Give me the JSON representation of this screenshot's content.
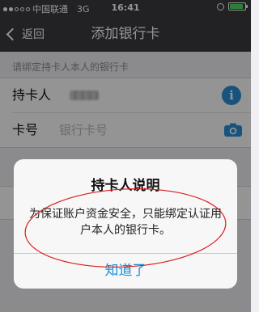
{
  "status_bar": {
    "carrier": "中国联通",
    "network": "3G",
    "time": "16:41",
    "battery_level": 0.9,
    "battery_color": "#4cd964"
  },
  "nav": {
    "back_label": "返回",
    "title": "添加银行卡"
  },
  "form": {
    "section_label": "请绑定持卡人本人的银行卡",
    "holder_label": "持卡人",
    "card_label": "卡号",
    "card_placeholder": "银行卡号",
    "info_icon": "info-icon",
    "camera_icon": "camera-icon"
  },
  "dialog": {
    "title": "持卡人说明",
    "message": "为保证账户资金安全，只能绑定认证用户本人的银行卡。",
    "confirm_label": "知道了",
    "confirm_color": "#1a8fd9"
  },
  "annotation_color": "#d9201f"
}
